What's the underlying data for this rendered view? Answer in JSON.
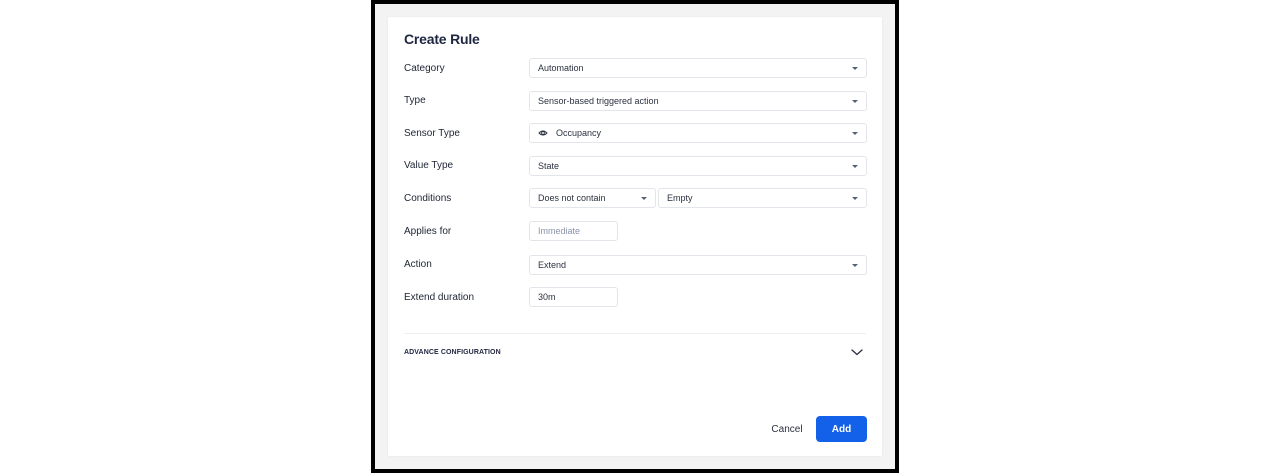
{
  "dialog": {
    "title": "Create Rule",
    "fields": {
      "category": {
        "label": "Category",
        "value": "Automation"
      },
      "type": {
        "label": "Type",
        "value": "Sensor-based triggered action"
      },
      "sensor_type": {
        "label": "Sensor Type",
        "value": "Occupancy",
        "icon": "eye-icon"
      },
      "value_type": {
        "label": "Value Type",
        "value": "State"
      },
      "conditions": {
        "label": "Conditions",
        "operator": "Does not contain",
        "value": "Empty"
      },
      "applies_for": {
        "label": "Applies for",
        "placeholder": "Immediate",
        "value": ""
      },
      "action": {
        "label": "Action",
        "value": "Extend"
      },
      "extend_duration": {
        "label": "Extend duration",
        "value": "30m"
      }
    },
    "advance_configuration": {
      "label": "ADVANCE CONFIGURATION",
      "icon": "chevron-down-icon"
    },
    "buttons": {
      "cancel": "Cancel",
      "add": "Add"
    },
    "colors": {
      "primary": "#1261e8",
      "title": "#1f2640"
    }
  }
}
